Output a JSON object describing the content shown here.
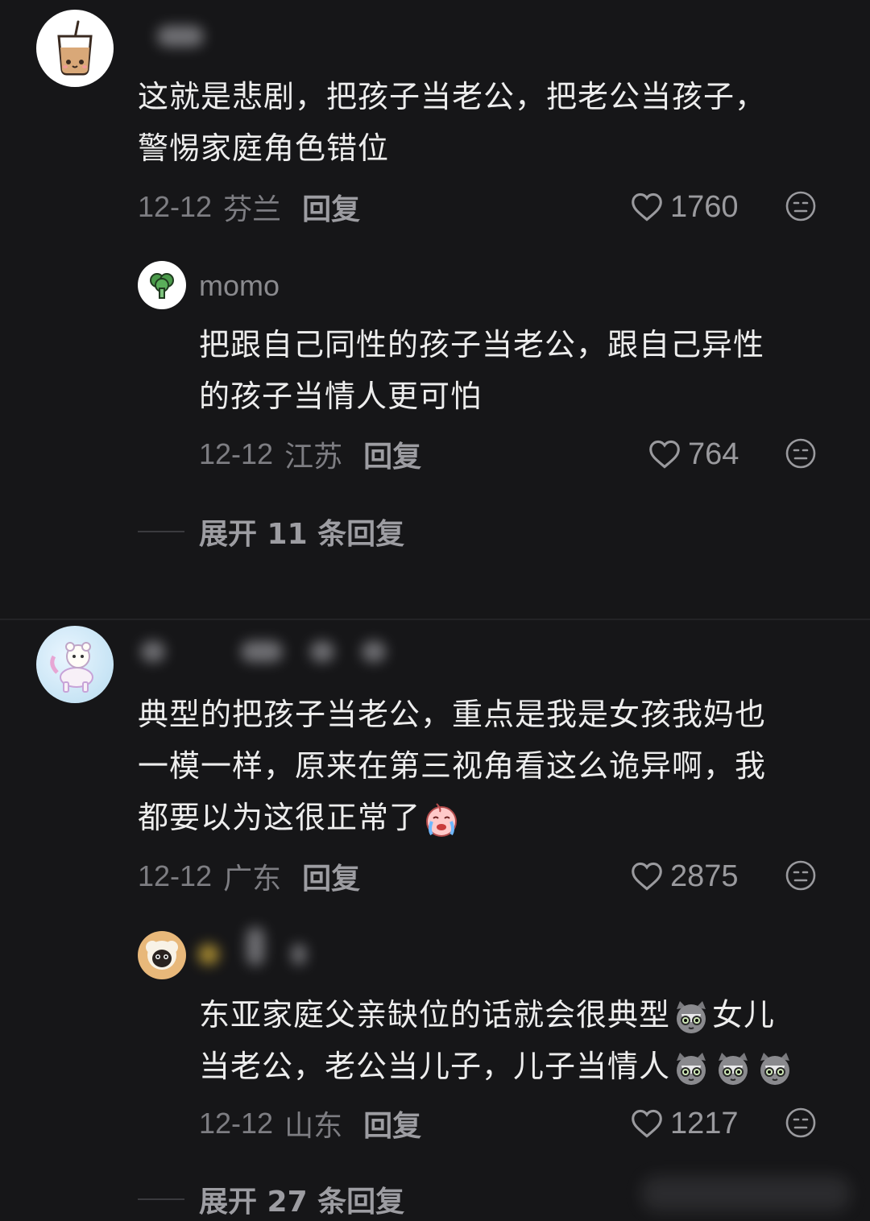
{
  "threads": [
    {
      "comment": {
        "content_lines": [
          "这就是悲剧，把孩子当老公，把老公当孩子，",
          "警惕家庭角色错位"
        ],
        "date": "12-12",
        "location": "芬兰",
        "reply_label": "回复",
        "likes": "1760"
      },
      "reply": {
        "username": "momo",
        "content_lines": [
          "把跟自己同性的孩子当老公，跟自己异性",
          "的孩子当情人更可怕"
        ],
        "date": "12-12",
        "location": "江苏",
        "reply_label": "回复",
        "likes": "764"
      },
      "expand_label": "展开 11 条回复"
    },
    {
      "comment": {
        "content_lines": [
          "典型的把孩子当老公，重点是我是女孩我妈也",
          "一模一样，原来在第三视角看这么诡异啊，我",
          "都要以为这很正常了"
        ],
        "date": "12-12",
        "location": "广东",
        "reply_label": "回复",
        "likes": "2875"
      },
      "reply": {
        "content_line1_a": "东亚家庭父亲缺位的话就会很典型",
        "content_line1_b": "女儿",
        "content_line2": "当老公，老公当儿子，儿子当情人",
        "date": "12-12",
        "location": "山东",
        "reply_label": "回复",
        "likes": "1217"
      },
      "expand_label": "展开 27 条回复"
    }
  ],
  "icons": {
    "like": "heart-outline-icon",
    "reaction": "neutral-face-icon"
  },
  "colors": {
    "background": "#161618",
    "text": "#ededed",
    "muted": "#7d7d82"
  }
}
